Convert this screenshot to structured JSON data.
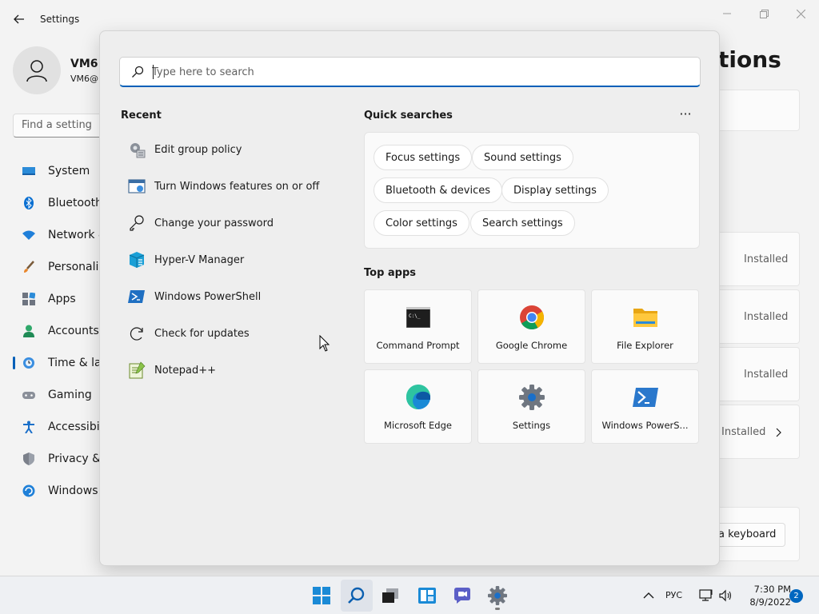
{
  "settings_window": {
    "title": "Settings",
    "profile": {
      "name": "VM6",
      "email": "VM6@"
    },
    "find_placeholder": "Find a setting",
    "nav": [
      {
        "label": "System",
        "icon": "monitor-icon"
      },
      {
        "label": "Bluetooth",
        "icon": "bluetooth-icon"
      },
      {
        "label": "Network &",
        "icon": "wifi-icon"
      },
      {
        "label": "Personaliza",
        "icon": "brush-icon"
      },
      {
        "label": "Apps",
        "icon": "apps-icon"
      },
      {
        "label": "Accounts",
        "icon": "person-icon"
      },
      {
        "label": "Time & lan",
        "icon": "clock-globe-icon"
      },
      {
        "label": "Gaming",
        "icon": "gamepad-icon"
      },
      {
        "label": "Accessibili",
        "icon": "accessibility-icon"
      },
      {
        "label": "Privacy & s",
        "icon": "shield-icon"
      },
      {
        "label": "Windows U",
        "icon": "update-icon"
      }
    ],
    "page_heading": "tions",
    "cards": [
      "Installed",
      "Installed",
      "Installed",
      "Installed"
    ],
    "keyboard_button": "a keyboard"
  },
  "search_panel": {
    "placeholder": "Type here to search",
    "recent_label": "Recent",
    "recent": [
      {
        "label": "Edit group policy",
        "icon": "group-policy-icon"
      },
      {
        "label": "Turn Windows features on or off",
        "icon": "windows-features-icon"
      },
      {
        "label": "Change your password",
        "icon": "key-icon"
      },
      {
        "label": "Hyper-V Manager",
        "icon": "hyperv-icon"
      },
      {
        "label": "Windows PowerShell",
        "icon": "powershell-icon"
      },
      {
        "label": "Check for updates",
        "icon": "refresh-icon"
      },
      {
        "label": "Notepad++",
        "icon": "notepad-plus-icon"
      }
    ],
    "quick_label": "Quick searches",
    "more": "···",
    "quick": [
      "Focus settings",
      "Sound settings",
      "Bluetooth & devices",
      "Display settings",
      "Color settings",
      "Search settings"
    ],
    "top_apps_label": "Top apps",
    "top_apps": [
      {
        "label": "Command Prompt",
        "icon": "cmd-icon"
      },
      {
        "label": "Google Chrome",
        "icon": "chrome-icon"
      },
      {
        "label": "File Explorer",
        "icon": "folder-icon"
      },
      {
        "label": "Microsoft Edge",
        "icon": "edge-icon"
      },
      {
        "label": "Settings",
        "icon": "gear-icon"
      },
      {
        "label": "Windows PowerS...",
        "icon": "powershell-icon"
      }
    ]
  },
  "taskbar": {
    "language": "РУС",
    "time": "7:30 PM",
    "date": "8/9/2022",
    "notifications": "2"
  },
  "colors": {
    "accent": "#005fb8",
    "badge": "#0067c0"
  }
}
